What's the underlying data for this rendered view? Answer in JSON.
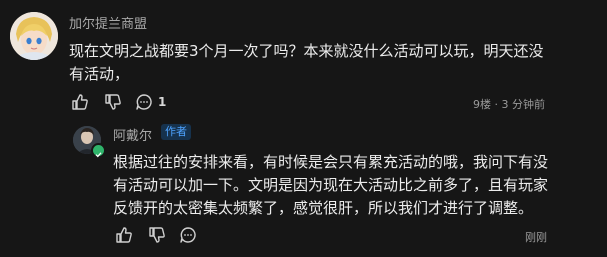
{
  "comment": {
    "author": "加尔提兰商盟",
    "text_line1": "现在文明之战都要3个月一次了吗？本来就没什么活动可以玩，明天还没",
    "text_line2": "有活动，",
    "reply_count": "1",
    "meta": "9楼 · 3 分钟前"
  },
  "reply": {
    "author": "阿戴尔",
    "tag": "作者",
    "text_line1": "根据过往的安排来看，有时候是会只有累充活动的哦，我问下有没",
    "text_line2": "有活动可以加一下。文明是因为现在大活动比之前多了，且有玩家",
    "text_line3": "反馈开的太密集太频繁了，感觉很肝，所以我们才进行了调整。",
    "meta": "刚刚"
  },
  "icons": {
    "like": "thumbs-up-icon",
    "dislike": "thumbs-down-icon",
    "reply": "comment-bubble-icon",
    "verified": "verified-badge-icon"
  },
  "colors": {
    "background": "#161616",
    "text": "#ececec",
    "muted": "#a9a9a9",
    "author_tag": "#4ea3ff",
    "verified_badge": "#2fb46b"
  }
}
